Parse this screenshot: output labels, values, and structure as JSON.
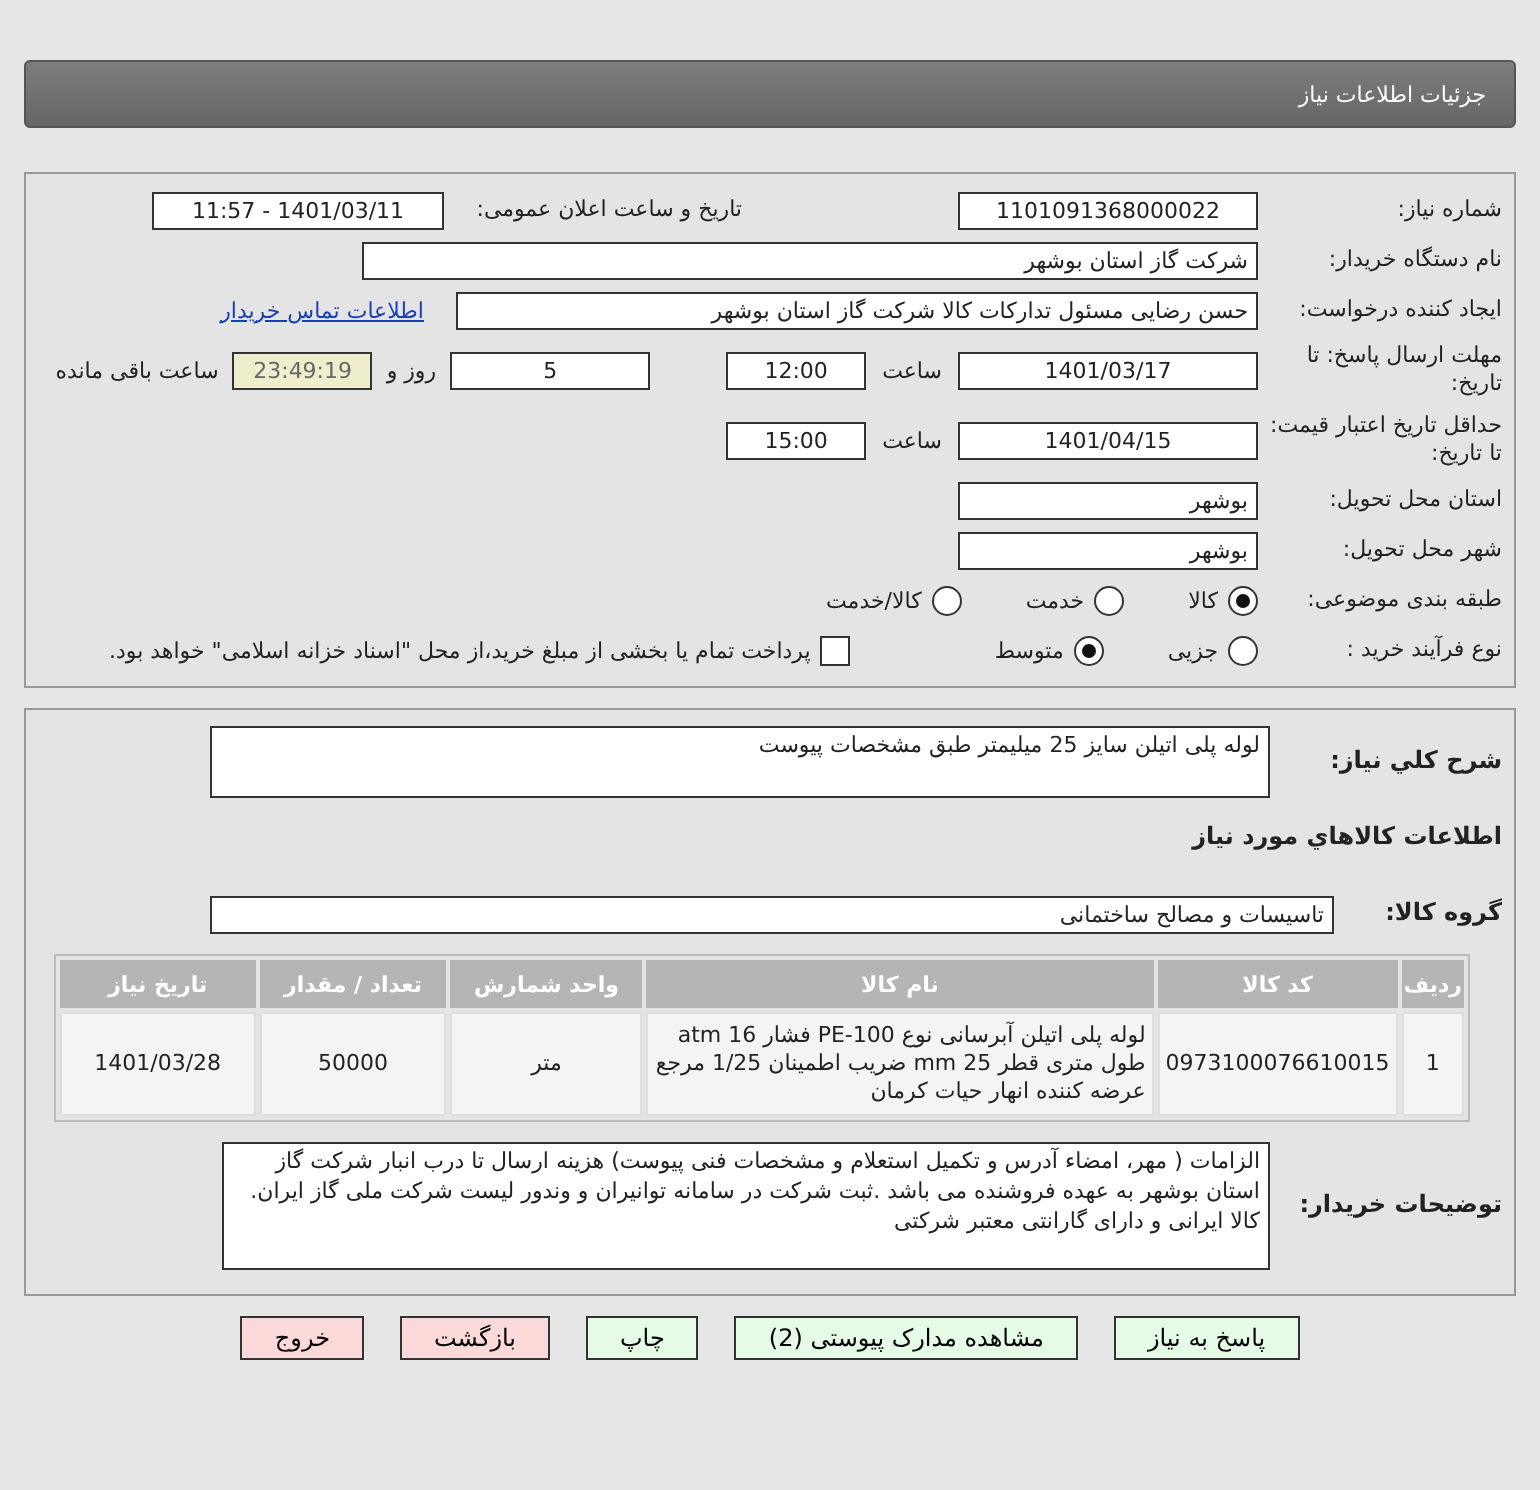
{
  "page_title": "جزئیات اطلاعات نیاز",
  "need_number": {
    "label": "شماره نیاز:",
    "value": "1101091368000022"
  },
  "announce": {
    "label": "تاریخ و ساعت اعلان عمومی:",
    "value": "1401/03/11 - 11:57"
  },
  "buyer_org": {
    "label": "نام دستگاه خریدار:",
    "value": "شرکت گاز استان بوشهر"
  },
  "requester": {
    "label": "ایجاد کننده درخواست:",
    "value": "حسن رضایی مسئول تدارکات کالا شرکت گاز استان بوشهر",
    "link": "اطلاعات تماس خریدار"
  },
  "deadline": {
    "label": "مهلت ارسال پاسخ: تا تاریخ:",
    "date": "1401/03/17",
    "time_label": "ساعت",
    "time": "12:00",
    "days": "5",
    "days_label": "روز و",
    "remaining": "23:49:19",
    "remaining_label": "ساعت باقی مانده"
  },
  "validity": {
    "label": "حداقل تاریخ اعتبار قیمت: تا تاریخ:",
    "date": "1401/04/15",
    "time_label": "ساعت",
    "time": "15:00"
  },
  "province": {
    "label": "استان محل تحویل:",
    "value": "بوشهر"
  },
  "city": {
    "label": "شهر محل تحویل:",
    "value": "بوشهر"
  },
  "category": {
    "label": "طبقه بندی موضوعی:",
    "options": [
      {
        "label": "کالا",
        "selected": true
      },
      {
        "label": "خدمت",
        "selected": false
      },
      {
        "label": "کالا/خدمت",
        "selected": false
      }
    ]
  },
  "process": {
    "label": "نوع فرآیند خرید :",
    "options": [
      {
        "label": "جزیی",
        "selected": false
      },
      {
        "label": "متوسط",
        "selected": true
      }
    ],
    "payment": {
      "label": "پرداخت تمام یا بخشی از مبلغ خرید،از محل \"اسناد خزانه اسلامی\" خواهد بود.",
      "checked": false
    }
  },
  "description": {
    "label": "شرح کلي نياز:",
    "value": "لوله پلی اتیلن سایز 25 میلیمتر طبق مشخصات پیوست"
  },
  "goods_heading": "اطلاعات کالاهاي مورد نياز",
  "group": {
    "label": "گروه کالا:",
    "value": "تاسیسات و مصالح ساختمانی"
  },
  "table": {
    "columns": [
      "ردیف",
      "کد کالا",
      "نام کالا",
      "واحد شمارش",
      "تعداد / مقدار",
      "تاریخ نیاز"
    ],
    "rows": [
      [
        "1",
        "0973100076610015",
        "لوله پلی اتیلن آبرسانی نوع PE-100 فشار 16 atm طول متری قطر 25 mm ضریب اطمینان 1/25 مرجع عرضه کننده انهار حیات کرمان",
        "متر",
        "50000",
        "1401/03/28"
      ]
    ]
  },
  "buyer_notes": {
    "label": "توضیحات خریدار:",
    "value": "الزامات ( مهر، امضاء آدرس و تکمیل استعلام و مشخصات فنی پیوست) هزینه ارسال تا درب انبار شرکت گاز استان بوشهر به عهده فروشنده می باشد .ثبت شرکت در سامانه توانیران و وندور لیست شرکت ملی گاز ایران. کالا ایرانی و دارای گارانتی معتبر شرکتی"
  },
  "buttons": [
    {
      "label": "پاسخ به نیاز",
      "kind": "action"
    },
    {
      "label": "مشاهده مدارک پیوستی (2)",
      "kind": "action"
    },
    {
      "label": "چاپ",
      "kind": "action"
    },
    {
      "label": "بازگشت",
      "kind": "exit"
    },
    {
      "label": "خروج",
      "kind": "exit"
    }
  ]
}
